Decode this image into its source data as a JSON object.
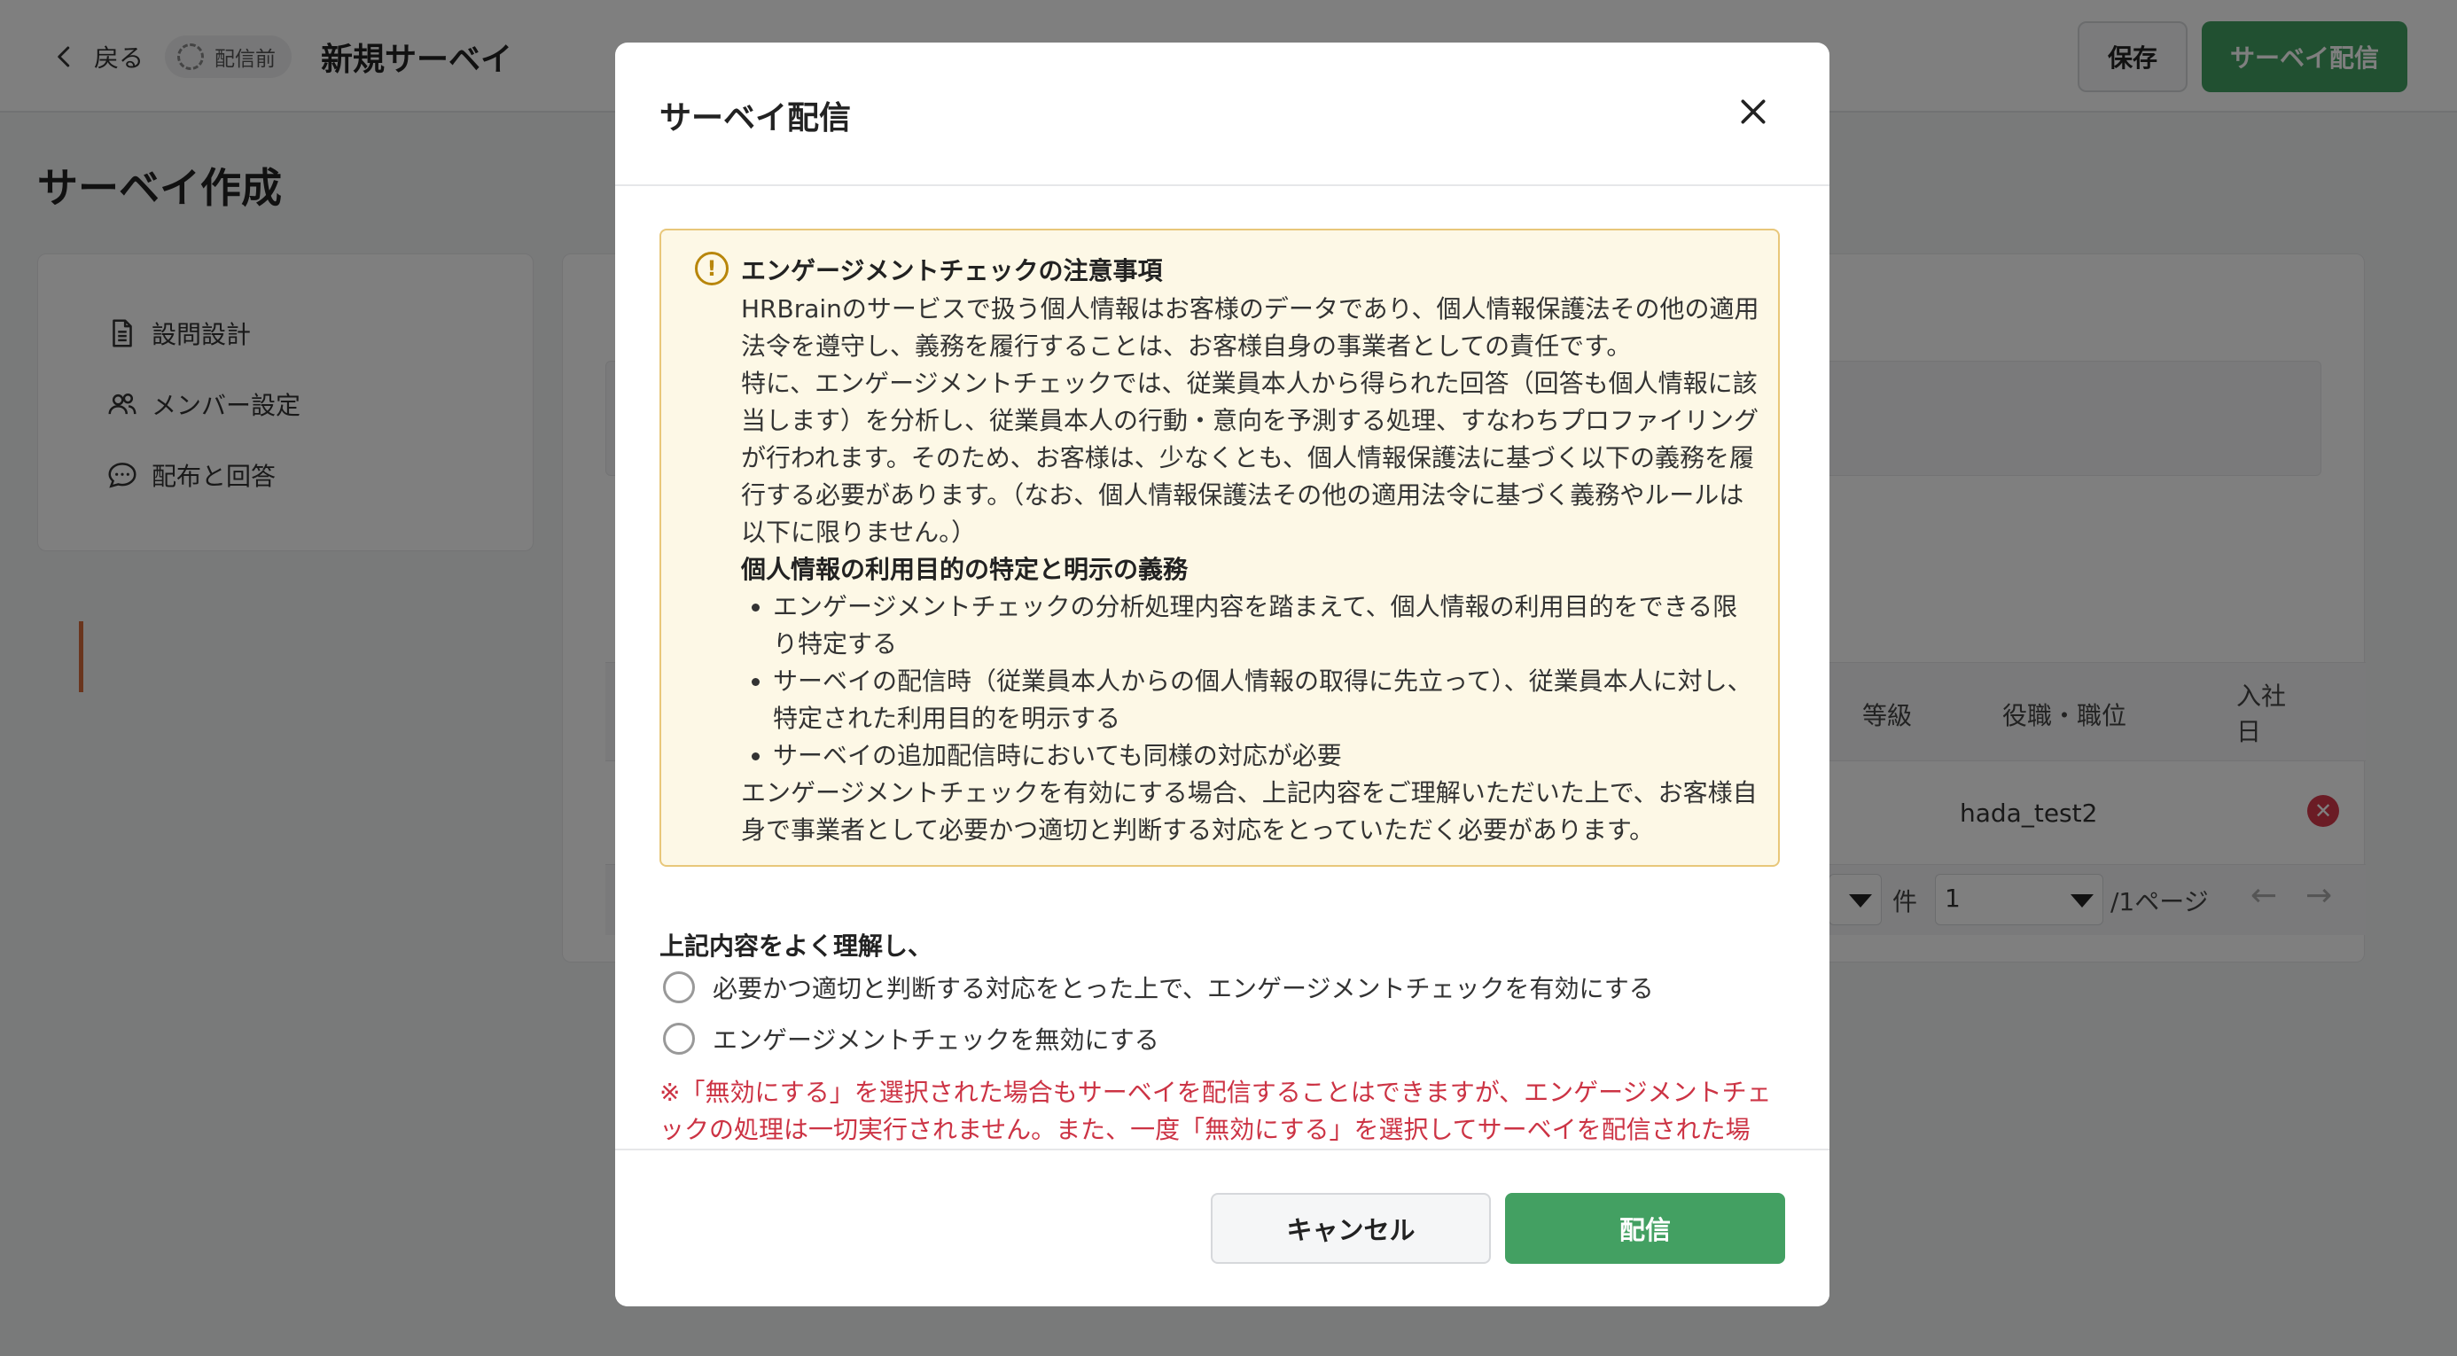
{
  "header": {
    "back_label": "戻る",
    "status": "配信前",
    "survey_title": "新規サーベイ",
    "save_label": "保存",
    "distribute_label": "サーベイ配信"
  },
  "page": {
    "title": "サーベイ作成"
  },
  "sidebar": {
    "items": [
      {
        "label": "設問設計",
        "icon": "document-icon"
      },
      {
        "label": "メンバー設定",
        "icon": "users-icon",
        "active": true
      },
      {
        "label": "配布と回答",
        "icon": "chat-icon"
      }
    ]
  },
  "background_table": {
    "col_grade_partial": "等級",
    "col_position": "役職・職位",
    "col_joined": "入社日",
    "row_position": "hada_test2",
    "pager_unit": "件",
    "pager_page_value": "1",
    "pager_pages_suffix": "/1ページ"
  },
  "modal": {
    "title": "サーベイ配信",
    "notice": {
      "title": "エンゲージメントチェックの注意事項",
      "para1": "HRBrainのサービスで扱う個人情報はお客様のデータであり、個人情報保護法その他の適用法令を遵守し、義務を履行することは、お客様自身の事業者としての責任です。",
      "para2": "特に、エンゲージメントチェックでは、従業員本人から得られた回答（回答も個人情報に該当します）を分析し、従業員本人の行動・意向を予測する処理、すなわちプロファイリングが行われます。そのため、お客様は、少なくとも、個人情報保護法に基づく以下の義務を履行する必要があります。（なお、個人情報保護法その他の適用法令に基づく義務やルールは以下に限りません。）",
      "subheading": "個人情報の利用目的の特定と明示の義務",
      "bullets": [
        "エンゲージメントチェックの分析処理内容を踏まえて、個人情報の利用目的をできる限り特定する",
        "サーベイの配信時（従業員本人からの個人情報の取得に先立って）、従業員本人に対し、特定された利用目的を明示する",
        "サーベイの追加配信時においても同様の対応が必要"
      ],
      "para3": "エンゲージメントチェックを有効にする場合、上記内容をご理解いただいた上で、お客様自身で事業者として必要かつ適切と判断する対応をとっていただく必要があります。"
    },
    "understand_label": "上記内容をよく理解し、",
    "options": [
      "必要かつ適切と判断する対応をとった上で、エンゲージメントチェックを有効にする",
      "エンゲージメントチェックを無効にする"
    ],
    "warning": "※「無効にする」を選択された場合もサーベイを配信することはできますが、エンゲージメントチェックの処理は一切実行されません。また、一度「無効にする」を選択してサーベイを配信された場合、後か",
    "cancel_label": "キャンセル",
    "send_label": "配信"
  },
  "colors": {
    "primary_green": "#43a062",
    "notice_bg": "#fdf8e6",
    "notice_border": "#e8c77a",
    "warning_red": "#cc3344",
    "active_accent": "#d56b3b"
  }
}
